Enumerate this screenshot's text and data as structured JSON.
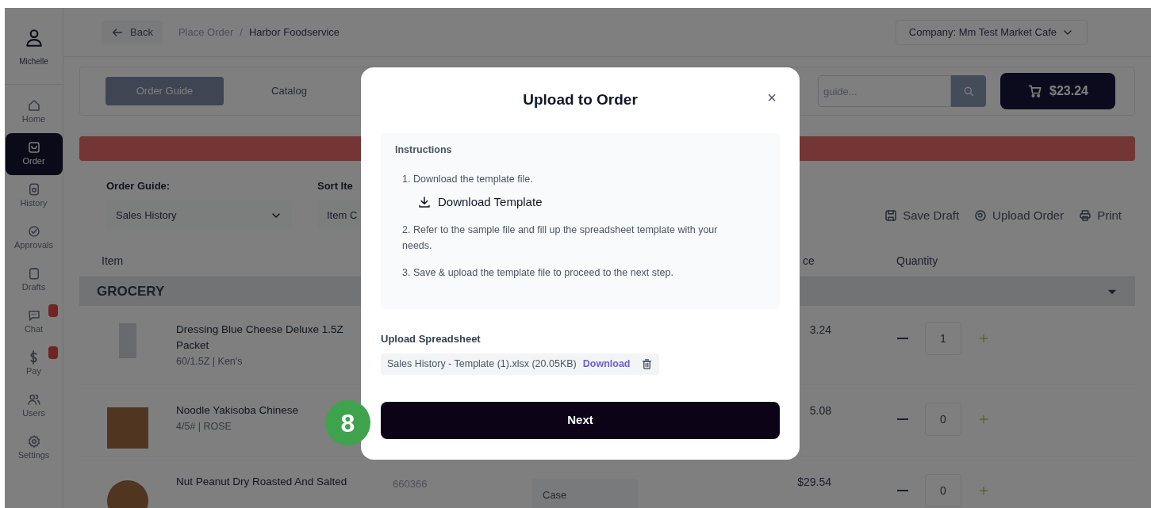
{
  "sidebar": {
    "user": {
      "name": "Michelle"
    },
    "items": [
      {
        "kind": "home",
        "label": "Home",
        "selected": false,
        "badge": false
      },
      {
        "kind": "order",
        "label": "Order",
        "selected": true,
        "badge": false
      },
      {
        "kind": "history",
        "label": "History",
        "selected": false,
        "badge": false
      },
      {
        "kind": "approvals",
        "label": "Approvals",
        "selected": false,
        "badge": false
      },
      {
        "kind": "drafts",
        "label": "Drafts",
        "selected": false,
        "badge": false
      },
      {
        "kind": "chat",
        "label": "Chat",
        "selected": false,
        "badge": true
      },
      {
        "kind": "pay",
        "label": "Pay",
        "selected": false,
        "badge": true
      },
      {
        "kind": "users",
        "label": "Users",
        "selected": false,
        "badge": false
      },
      {
        "kind": "settings",
        "label": "Settings",
        "selected": false,
        "badge": false
      }
    ]
  },
  "header": {
    "back": "Back",
    "breadcrumb": [
      "Place Order",
      "Harbor Foodservice"
    ],
    "breadcrumb_separator": "/",
    "company_label": "Company:",
    "company": "Mm Test Market Cafe"
  },
  "tabs": [
    {
      "label": "Order Guide",
      "selected": true
    },
    {
      "label": "Catalog",
      "selected": false
    }
  ],
  "search": {
    "placeholder": "guide..."
  },
  "cart": {
    "total": "$23.24"
  },
  "filters": [
    {
      "label": "Order Guide:",
      "value": "Sales History",
      "chevron": true
    },
    {
      "label": "Sort Ite",
      "value": "Item C"
    }
  ],
  "actions": [
    {
      "kind": "save",
      "label": "Save Draft"
    },
    {
      "kind": "upload",
      "label": "Upload Order"
    },
    {
      "kind": "print",
      "label": "Print"
    }
  ],
  "table": {
    "columns": [
      "Item",
      "ce",
      "Quantity"
    ],
    "group": {
      "label": "GROCERY",
      "expanded": true
    },
    "rows": [
      {
        "name": "Dressing Blue Cheese Deluxe 1.5Z Packet",
        "details": "60/1.5Z | Ken's",
        "price": "3.24",
        "quantity": "1"
      },
      {
        "name": "Noodle Yakisoba Chinese",
        "details": "4/5# | ROSE",
        "price": "5.08",
        "quantity": "0"
      },
      {
        "name": "Nut Peanut Dry Roasted And Salted",
        "code": "660366",
        "unit": "Case",
        "price": "$29.54",
        "quantity": "0"
      }
    ]
  },
  "modal": {
    "title": "Upload to Order",
    "close": "×",
    "instructions": {
      "heading": "Instructions",
      "steps": [
        {
          "text": "1. Download the template file.",
          "action": "Download Template"
        },
        {
          "text": "2. Refer to the sample file and fill up the spreadsheet template with your needs."
        },
        {
          "text": "3. Save & upload the template file to proceed to the next step."
        }
      ]
    },
    "upload_label": "Upload Spreadsheet",
    "file": {
      "name": "Sales History - Template (1).xlsx",
      "size": "(20.05KB)",
      "download": "Download"
    },
    "next": "Next"
  },
  "step_badge": "8"
}
